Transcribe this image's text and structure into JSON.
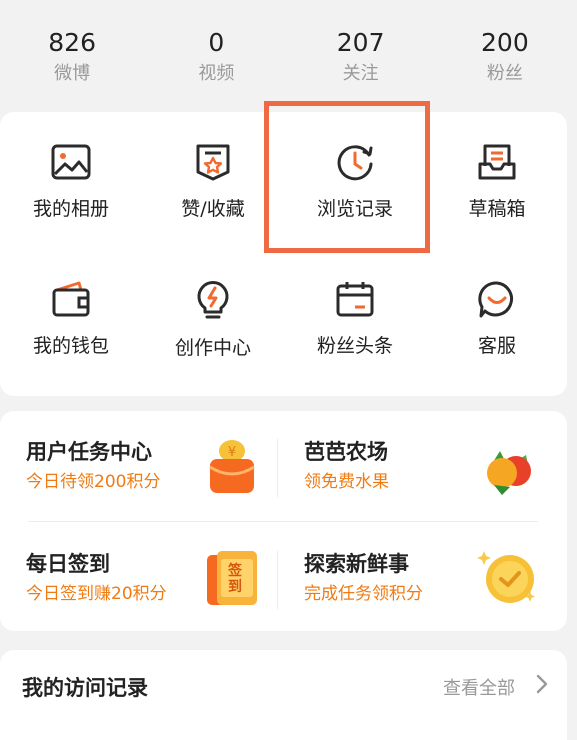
{
  "stats": [
    {
      "value": "826",
      "label": "微博"
    },
    {
      "value": "0",
      "label": "视频"
    },
    {
      "value": "207",
      "label": "关注"
    },
    {
      "value": "200",
      "label": "粉丝"
    }
  ],
  "grid": [
    {
      "label": "我的相册",
      "icon": "photo-album-icon"
    },
    {
      "label": "赞/收藏",
      "icon": "favorite-badge-icon"
    },
    {
      "label": "浏览记录",
      "icon": "history-clock-icon"
    },
    {
      "label": "草稿箱",
      "icon": "drafts-tray-icon"
    },
    {
      "label": "我的钱包",
      "icon": "wallet-icon"
    },
    {
      "label": "创作中心",
      "icon": "bulb-lightning-icon"
    },
    {
      "label": "粉丝头条",
      "icon": "calendar-icon"
    },
    {
      "label": "客服",
      "icon": "chat-smile-icon"
    }
  ],
  "tasks": [
    {
      "title": "用户任务中心",
      "subtitle": "今日待领200积分",
      "icon": "coin-gift-icon"
    },
    {
      "title": "芭芭农场",
      "subtitle": "领免费水果",
      "icon": "fruit-icon"
    },
    {
      "title": "每日签到",
      "subtitle": "今日签到赚20积分",
      "icon": "checkin-card-icon"
    },
    {
      "title": "探索新鲜事",
      "subtitle": "完成任务领积分",
      "icon": "gold-check-coin-icon"
    }
  ],
  "visits": {
    "title": "我的访问记录",
    "more": "查看全部"
  },
  "colors": {
    "accent": "#f07b13",
    "highlight": "#ee6a44",
    "icon_dark": "#2b2b2b",
    "icon_orange": "#f26a2e"
  },
  "badges": {
    "checkin": "签到"
  }
}
